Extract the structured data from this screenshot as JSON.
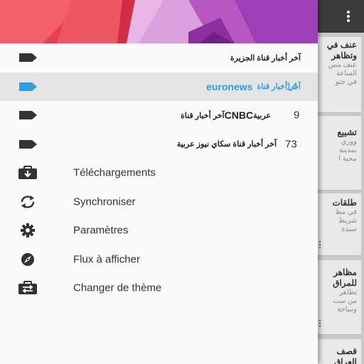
{
  "colors": {
    "accent": "#2f9de0",
    "drawer_background": "#fafafa",
    "selected_row": "#e4e4e4",
    "icon_dark": "#333333",
    "toolbar": "#3b3b3b"
  },
  "feeds": [
    {
      "name": "آخر أخبار قناة الجزيرة",
      "name_latin": "",
      "count": "",
      "selected": false,
      "icon": "label-icon"
    },
    {
      "name": "آخر أخبار قناة ",
      "name_latin": "euronews",
      "count": "14",
      "selected": true,
      "icon": "label-icon"
    },
    {
      "name": "عربية",
      "name_latin": "CNBC",
      "name_suffix": " آخر أخبار قناة",
      "count": "9",
      "selected": false,
      "icon": "label-icon"
    },
    {
      "name": "آخر أخبار قناة سكاي نيوز عربية",
      "name_latin": "",
      "count": "73",
      "selected": false,
      "icon": "label-icon"
    }
  ],
  "actions": [
    {
      "label": "Téléchargements",
      "icon": "downloads-icon"
    },
    {
      "label": "Synchroniser",
      "icon": "sync-icon"
    },
    {
      "label": "Paramètres",
      "icon": "settings-gear-icon"
    },
    {
      "label": "Flux à afficher",
      "icon": "compass-icon"
    },
    {
      "label": "Changer de thème",
      "icon": "theme-switch-icon"
    }
  ],
  "background_cards": [
    {
      "title": "عنف في",
      "lines": [
        "وتظاهر",
        "عنف مس",
        "الساعة",
        "في جنو"
      ]
    },
    {
      "title": "تشييع",
      "lines": [
        "ووري",
        "بمدينة",
        "محبة ا"
      ]
    },
    {
      "title": "طلقات",
      "lines": [
        "في مظ",
        "شريط ",
        "سيدة"
      ]
    },
    {
      "title": "مظاهر",
      "lines": [
        "للمراق",
        "تظاهر",
        "من ست",
        "وساحة"
      ]
    },
    {
      "title": "قصف",
      "lines": [
        "العراق"
      ]
    }
  ]
}
